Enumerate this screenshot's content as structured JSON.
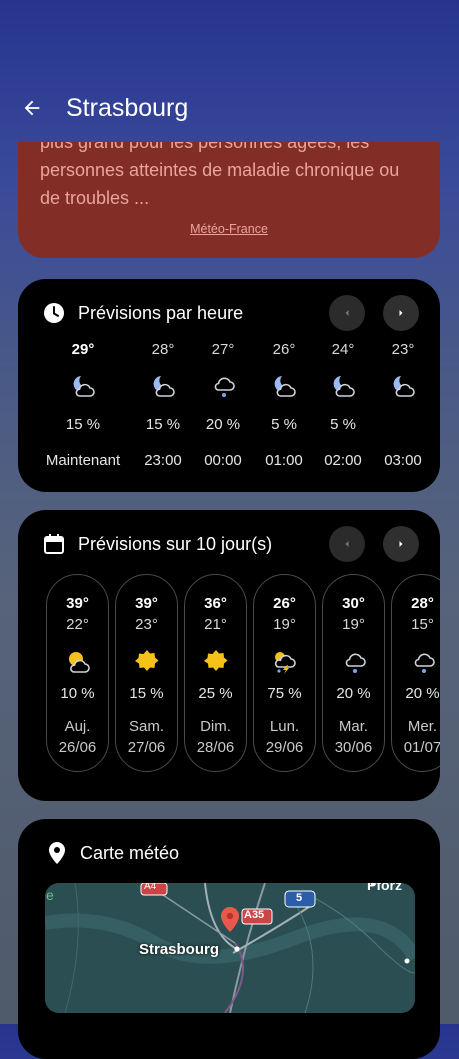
{
  "header": {
    "title": "Strasbourg"
  },
  "alert": {
    "text": "plus grand pour les personnes âgées, les personnes atteintes de maladie chronique ou de troubles ...",
    "source": "Météo-France"
  },
  "hourly": {
    "title": "Prévisions par heure",
    "items": [
      {
        "temp": "29°",
        "precip": "15 %",
        "time": "Maintenant",
        "icon": "partly-cloudy-night-icon"
      },
      {
        "temp": "28°",
        "precip": "15 %",
        "time": "23:00",
        "icon": "partly-cloudy-night-icon"
      },
      {
        "temp": "27°",
        "precip": "20 %",
        "time": "00:00",
        "icon": "drizzle-icon"
      },
      {
        "temp": "26°",
        "precip": "5 %",
        "time": "01:00",
        "icon": "partly-cloudy-night-icon"
      },
      {
        "temp": "24°",
        "precip": "5 %",
        "time": "02:00",
        "icon": "partly-cloudy-night-icon"
      },
      {
        "temp": "23°",
        "precip": "",
        "time": "03:00",
        "icon": "partly-cloudy-night-icon"
      }
    ]
  },
  "daily": {
    "title": "Prévisions sur 10 jour(s)",
    "items": [
      {
        "hi": "39°",
        "lo": "22°",
        "precip": "10 %",
        "day": "Auj.",
        "date": "26/06",
        "icon": "partly-cloudy-sun-icon"
      },
      {
        "hi": "39°",
        "lo": "23°",
        "precip": "15 %",
        "day": "Sam.",
        "date": "27/06",
        "icon": "sun-icon"
      },
      {
        "hi": "36°",
        "lo": "21°",
        "precip": "25 %",
        "day": "Dim.",
        "date": "28/06",
        "icon": "sun-icon"
      },
      {
        "hi": "26°",
        "lo": "19°",
        "precip": "75 %",
        "day": "Lun.",
        "date": "29/06",
        "icon": "thunderstorm-icon"
      },
      {
        "hi": "30°",
        "lo": "19°",
        "precip": "20 %",
        "day": "Mar.",
        "date": "30/06",
        "icon": "drizzle-icon"
      },
      {
        "hi": "28°",
        "lo": "15°",
        "precip": "20 %",
        "day": "Mer.",
        "date": "01/07",
        "icon": "drizzle-icon"
      }
    ]
  },
  "map": {
    "title": "Carte météo",
    "labels": {
      "city": "Strasbourg",
      "road_a4": "A4",
      "road_a35": "A35",
      "road_5": "5",
      "pforz": "Pforz",
      "edge": "e"
    }
  },
  "colors": {
    "alert_bg": "#822e27",
    "card_bg": "#000000",
    "sun": "#f6c21a",
    "moon": "#9bb9f2"
  }
}
